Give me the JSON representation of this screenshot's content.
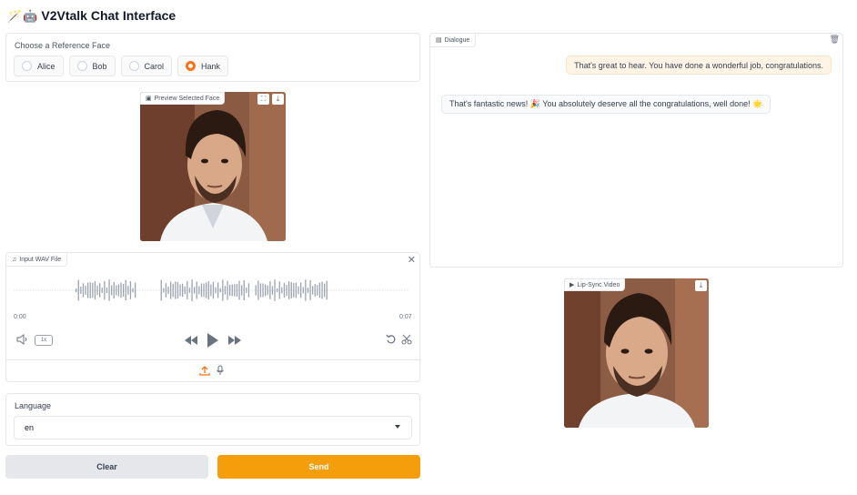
{
  "app": {
    "title": "V2Vtalk Chat Interface",
    "title_icons": [
      "magic-wand-icon",
      "robot-icon"
    ]
  },
  "reference_face": {
    "label": "Choose a Reference Face",
    "options": [
      "Alice",
      "Bob",
      "Carol",
      "Hank"
    ],
    "selected": "Hank"
  },
  "preview": {
    "label": "Preview Selected Face",
    "icons": [
      "fullscreen-icon",
      "download-icon"
    ]
  },
  "audio": {
    "label": "Input WAV File",
    "time_start": "0:00",
    "time_end": "0:07",
    "speed": "1x",
    "icons": [
      "volume-icon",
      "rewind-icon",
      "play-icon",
      "fast-forward-icon",
      "undo-icon",
      "scissors-icon",
      "upload-icon",
      "microphone-icon",
      "close-icon"
    ]
  },
  "language": {
    "label": "Language",
    "value": "en"
  },
  "buttons": {
    "clear": "Clear",
    "send": "Send"
  },
  "dialogue": {
    "label": "Dialogue",
    "messages": [
      {
        "role": "user",
        "text": "That's great to hear. You have done a wonderful job, congratulations."
      },
      {
        "role": "assistant",
        "text": "That's fantastic news! 🎉 You absolutely deserve all the congratulations, well done! 🌟"
      }
    ]
  },
  "lip_sync": {
    "label": "Lip-Sync Video",
    "icons": [
      "download-icon"
    ]
  },
  "colors": {
    "accent": "#f59e0b",
    "radio_selected": "#f97316",
    "user_bubble": "#fff4e6"
  }
}
